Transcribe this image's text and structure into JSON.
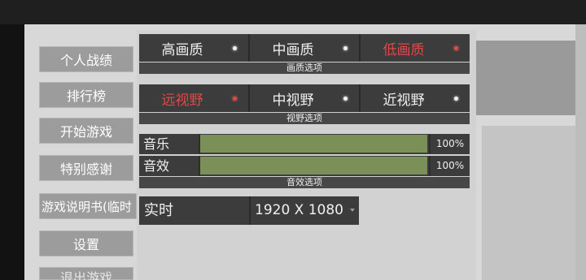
{
  "menu": {
    "items": [
      {
        "label": "个人战绩"
      },
      {
        "label": "排行榜"
      },
      {
        "label": "开始游戏"
      },
      {
        "label": "特别感谢"
      },
      {
        "label": "游戏说明书(临时"
      },
      {
        "label": "设置"
      },
      {
        "label": "退出游戏"
      }
    ]
  },
  "quality": {
    "options": [
      {
        "label": "高画质",
        "selected": false
      },
      {
        "label": "中画质",
        "selected": false
      },
      {
        "label": "低画质",
        "selected": true
      }
    ],
    "caption": "画质选项"
  },
  "view": {
    "options": [
      {
        "label": "远视野",
        "selected": true
      },
      {
        "label": "中视野",
        "selected": false
      },
      {
        "label": "近视野",
        "selected": false
      }
    ],
    "caption": "视野选项"
  },
  "audio": {
    "music": {
      "label": "音乐",
      "percent": "100%",
      "level": 1.0
    },
    "sfx": {
      "label": "音效",
      "percent": "100%",
      "level": 1.0
    },
    "caption": "音效选项"
  },
  "display": {
    "mode_label": "实时",
    "resolution": "1920 X 1080"
  },
  "colors": {
    "selected": "#e04848",
    "volume_fill": "#7b9057",
    "panel": "#3c3c3c"
  }
}
